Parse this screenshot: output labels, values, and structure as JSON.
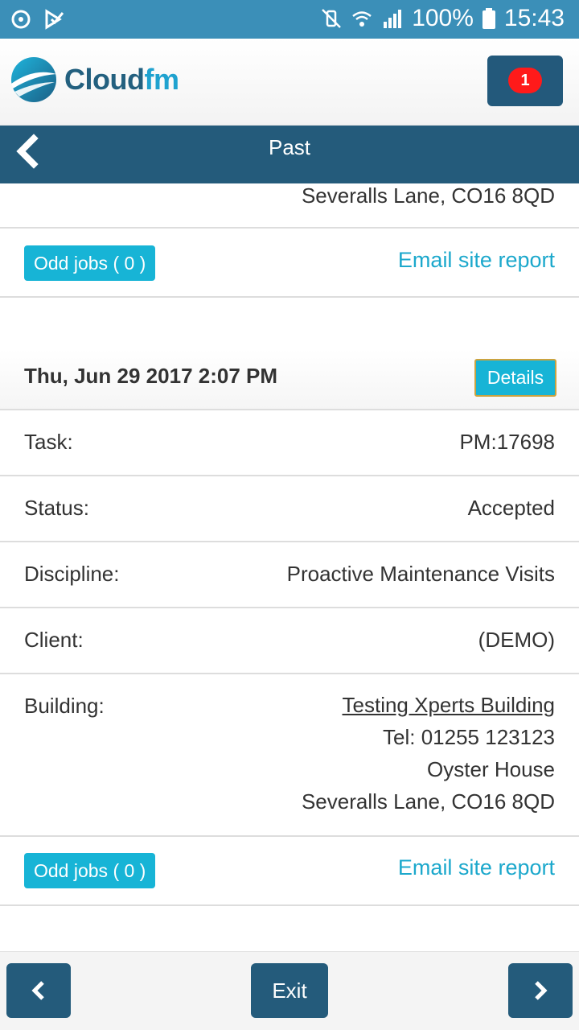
{
  "status_bar": {
    "battery": "100%",
    "time": "15:43",
    "icons": [
      "sync-icon",
      "check-cast-icon",
      "mute-vibrate-icon",
      "wifi-icon",
      "signal-icon",
      "battery-icon"
    ]
  },
  "header": {
    "logo_text_cloud": "Cloud",
    "logo_text_fm": "fm",
    "notification_count": "1"
  },
  "titlebar": {
    "title": "Past"
  },
  "prev_entry": {
    "address_line": "Severalls Lane, CO16 8QD",
    "odd_jobs_label": "Odd jobs ( 0 )",
    "email_label": "Email site report"
  },
  "entry": {
    "date": "Thu, Jun 29 2017 2:07 PM",
    "details_label": "Details",
    "fields": {
      "task": {
        "label": "Task:",
        "value": "PM:17698"
      },
      "status": {
        "label": "Status:",
        "value": "Accepted"
      },
      "discipline": {
        "label": "Discipline:",
        "value": "Proactive Maintenance Visits"
      },
      "client": {
        "label": "Client:",
        "value": "(DEMO)"
      },
      "building": {
        "label": "Building:",
        "name": "Testing Xperts Building",
        "tel": "Tel: 01255 123123",
        "line1": "Oyster House",
        "line2": "Severalls Lane, CO16 8QD"
      }
    },
    "odd_jobs_label": "Odd jobs ( 0 )",
    "email_label": "Email site report"
  },
  "footer": {
    "exit_label": "Exit"
  },
  "colors": {
    "status_bar": "#3b8fb8",
    "brand_dark": "#245b7b",
    "accent": "#17b4d6",
    "badge": "#ff1a1a"
  }
}
